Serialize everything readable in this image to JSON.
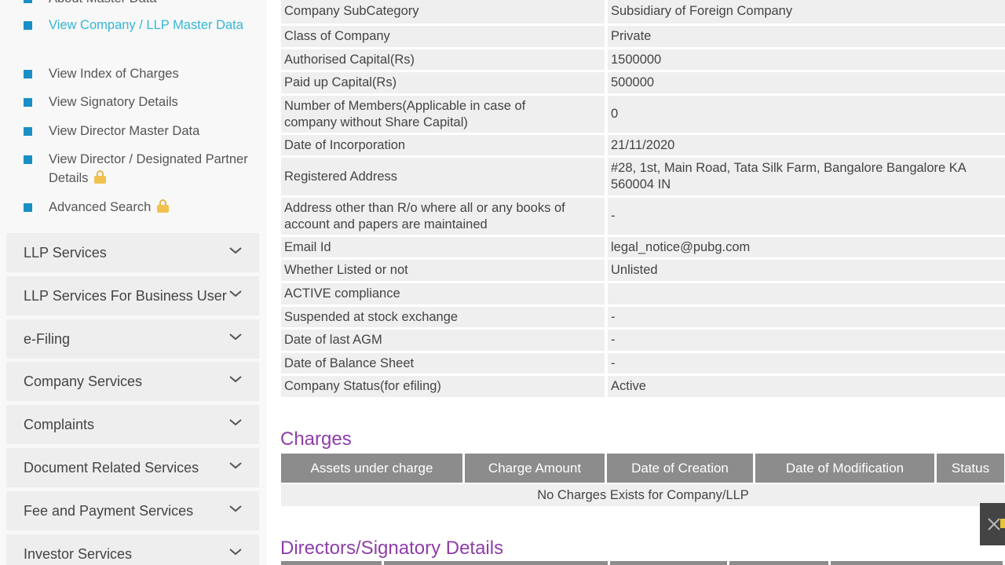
{
  "sidebar": {
    "top_partial_label": "About Master Data",
    "sub_links": [
      {
        "label": "View Company / LLP Master Data",
        "active": true,
        "locked": false
      },
      {
        "label": "View Index of Charges",
        "active": false,
        "locked": false
      },
      {
        "label": "View Signatory Details",
        "active": false,
        "locked": false
      },
      {
        "label": "View Director Master Data",
        "active": false,
        "locked": false
      },
      {
        "label": "View Director / Designated Partner Details",
        "active": false,
        "locked": true
      },
      {
        "label": "Advanced Search",
        "active": false,
        "locked": true
      }
    ],
    "accordions": [
      "LLP Services",
      "LLP Services For Business User",
      "e-Filing",
      "Company Services",
      "Complaints",
      "Document Related Services",
      "Fee and Payment Services",
      "Investor Services"
    ]
  },
  "details": [
    {
      "label": "Company SubCategory",
      "value": "Subsidiary of Foreign Company"
    },
    {
      "label": "Class of Company",
      "value": "Private"
    },
    {
      "label": "Authorised Capital(Rs)",
      "value": "1500000"
    },
    {
      "label": "Paid up Capital(Rs)",
      "value": "500000"
    },
    {
      "label": "Number of Members(Applicable in case of company without Share Capital)",
      "value": "0"
    },
    {
      "label": "Date of Incorporation",
      "value": "21/11/2020"
    },
    {
      "label": "Registered Address",
      "value": "#28, 1st, Main Road, Tata Silk Farm, Bangalore Bangalore KA 560004 IN"
    },
    {
      "label": "Address other than R/o where all or any books of account and papers are maintained",
      "value": "-"
    },
    {
      "label": "Email Id",
      "value": "legal_notice@pubg.com"
    },
    {
      "label": "Whether Listed or not",
      "value": "Unlisted"
    },
    {
      "label": "ACTIVE compliance",
      "value": ""
    },
    {
      "label": "Suspended at stock exchange",
      "value": "-"
    },
    {
      "label": "Date of last AGM",
      "value": "-"
    },
    {
      "label": "Date of Balance Sheet",
      "value": "-"
    },
    {
      "label": "Company Status(for efiling)",
      "value": "Active"
    }
  ],
  "charges": {
    "title": "Charges",
    "columns": [
      "Assets under charge",
      "Charge Amount",
      "Date of Creation",
      "Date of Modification",
      "Status"
    ],
    "empty_message": "No Charges Exists for Company/LLP"
  },
  "directors": {
    "title": "Directors/Signatory Details"
  },
  "colors": {
    "active_link": "#35b6d6",
    "bullet": "#1a8fc6",
    "section_title": "#8e3ea8",
    "table_header": "#8c8c8c",
    "row_bg": "#efefef"
  }
}
